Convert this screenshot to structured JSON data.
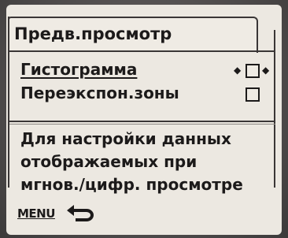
{
  "menu": {
    "title": "Предв.просмотр",
    "items": [
      {
        "label": "Гистограмма",
        "checked": false,
        "selected": true
      },
      {
        "label": "Переэкспон.зоны",
        "checked": false,
        "selected": false
      }
    ]
  },
  "description": [
    "Для настройки данных",
    "отображаемых при",
    "мгнов./цифр. просмотре"
  ],
  "footer": {
    "button_label": "MENU",
    "icon": "back-arrow-icon"
  }
}
